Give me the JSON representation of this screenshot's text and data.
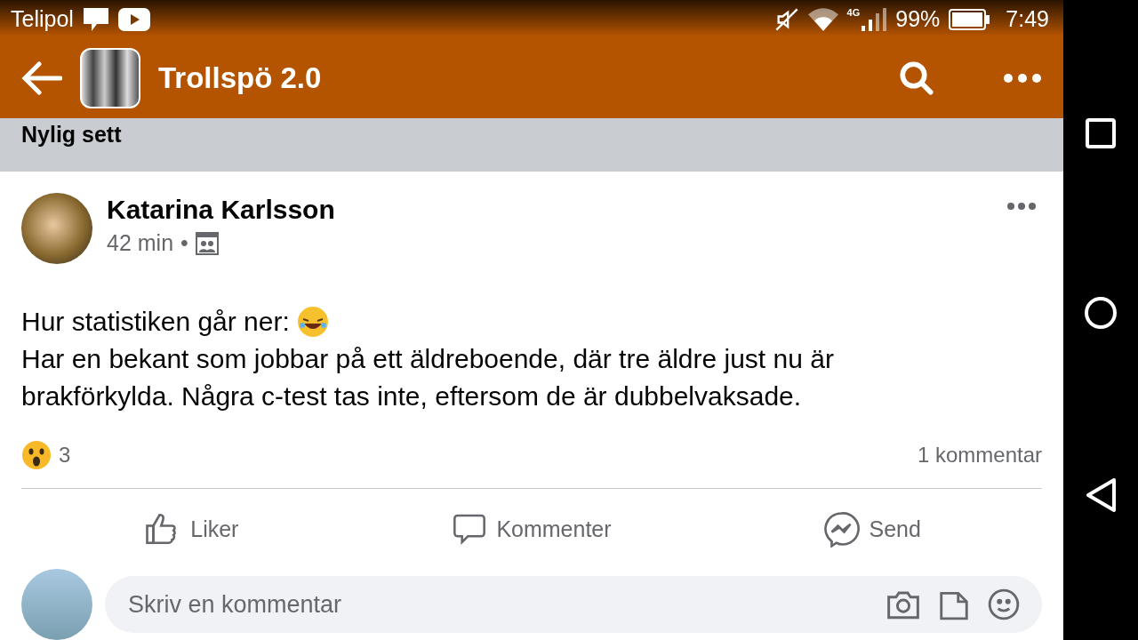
{
  "status_bar": {
    "carrier": "Telipol",
    "network": "4G",
    "battery": "99%",
    "time": "7:49"
  },
  "app_bar": {
    "title": "Trollspö 2.0"
  },
  "section": {
    "title": "Nylig sett"
  },
  "post": {
    "author": "Katarina Karlsson",
    "time": "42 min",
    "separator": "•",
    "lines": [
      "Hur statistiken går ner:",
      "Har en bekant som jobbar på ett äldreboende, där tre äldre just nu är brakförkylda. Några c-test tas inte, eftersom de är dubbelvaksade."
    ],
    "reaction_count": "3",
    "comment_count": "1 kommentar"
  },
  "actions": [
    {
      "kind": "like",
      "label": "Liker"
    },
    {
      "kind": "comment",
      "label": "Kommenter"
    },
    {
      "kind": "send",
      "label": "Send"
    }
  ],
  "comment_field": {
    "placeholder": "Skriv en kommentar"
  }
}
